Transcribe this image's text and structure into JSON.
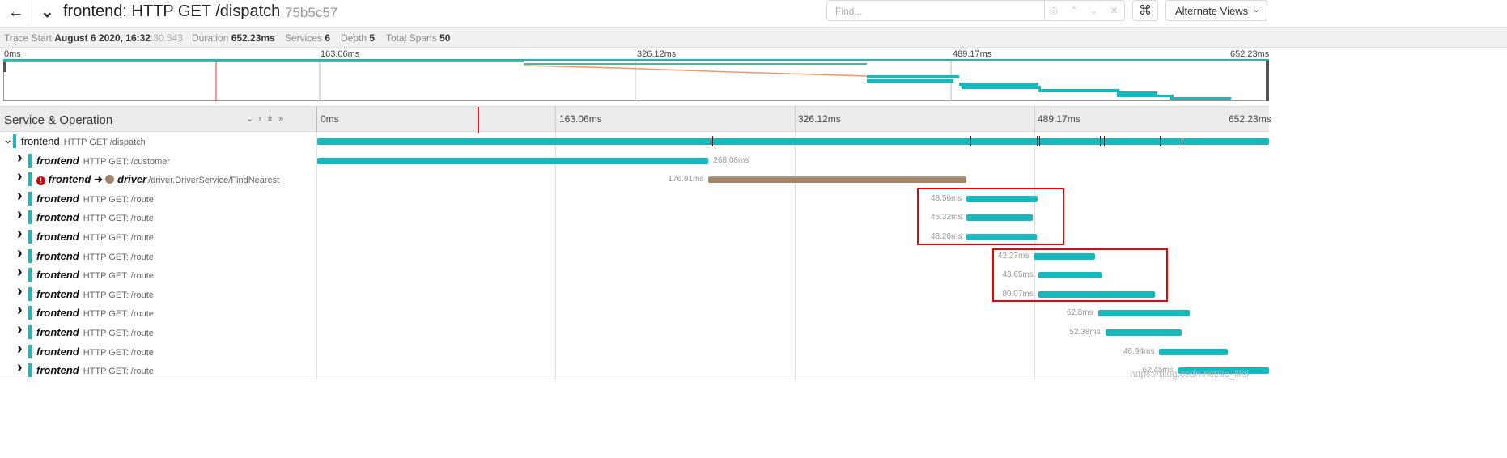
{
  "header": {
    "back_icon": "arrow-left-icon",
    "title": "frontend: HTTP GET /dispatch",
    "trace_id": "75b5c57",
    "find_placeholder": "Find...",
    "alternate_views_label": "Alternate Views"
  },
  "stats": {
    "trace_start_label": "Trace Start",
    "trace_start_value": "August 6 2020, 16:32",
    "trace_start_ms": ":30.543",
    "duration_label": "Duration",
    "duration_value": "652.23ms",
    "services_label": "Services",
    "services_value": "6",
    "depth_label": "Depth",
    "depth_value": "5",
    "total_spans_label": "Total Spans",
    "total_spans_value": "50"
  },
  "timeline": {
    "total_ms": 652.23,
    "ticks": [
      "0ms",
      "163.06ms",
      "326.12ms",
      "489.17ms",
      "652.23ms"
    ],
    "column_title": "Service & Operation"
  },
  "spans": [
    {
      "service": "frontend",
      "operation": "HTTP GET /dispatch",
      "start": 0,
      "duration": 652.23,
      "label": "",
      "root": true
    },
    {
      "service": "frontend",
      "operation": "HTTP GET: /customer",
      "start": 0,
      "duration": 268.08,
      "label": "268.08ms"
    },
    {
      "service": "frontend",
      "operation": "/driver.DriverService/FindNearest",
      "remote_service": "driver",
      "start": 268.08,
      "duration": 176.91,
      "label": "176.91ms",
      "error": true
    },
    {
      "service": "frontend",
      "operation": "HTTP GET: /route",
      "start": 445.0,
      "duration": 48.56,
      "label": "48.56ms"
    },
    {
      "service": "frontend",
      "operation": "HTTP GET: /route",
      "start": 445.0,
      "duration": 45.32,
      "label": "45.32ms"
    },
    {
      "service": "frontend",
      "operation": "HTTP GET: /route",
      "start": 445.0,
      "duration": 48.26,
      "label": "48.26ms"
    },
    {
      "service": "frontend",
      "operation": "HTTP GET: /route",
      "start": 491.0,
      "duration": 42.27,
      "label": "42.27ms"
    },
    {
      "service": "frontend",
      "operation": "HTTP GET: /route",
      "start": 494.0,
      "duration": 43.65,
      "label": "43.65ms"
    },
    {
      "service": "frontend",
      "operation": "HTTP GET: /route",
      "start": 494.0,
      "duration": 80.07,
      "label": "80.07ms"
    },
    {
      "service": "frontend",
      "operation": "HTTP GET: /route",
      "start": 535.0,
      "duration": 62.8,
      "label": "62.8ms"
    },
    {
      "service": "frontend",
      "operation": "HTTP GET: /route",
      "start": 540.0,
      "duration": 52.38,
      "label": "52.38ms"
    },
    {
      "service": "frontend",
      "operation": "HTTP GET: /route",
      "start": 577.0,
      "duration": 46.94,
      "label": "46.94ms"
    },
    {
      "service": "frontend",
      "operation": "HTTP GET: /route",
      "start": 590.0,
      "duration": 62.45,
      "label": "62.45ms"
    }
  ],
  "watermark": "https://blog.csdn.net/sc_lilei",
  "colors": {
    "frontend": "#17b8be",
    "driver": "#a0856b",
    "error": "#d60000"
  }
}
